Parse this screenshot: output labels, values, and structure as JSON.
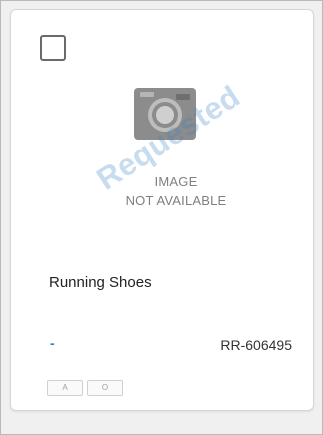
{
  "card": {
    "image_placeholder": {
      "icon": "camera-icon",
      "line1": "IMAGE",
      "line2": "NOT AVAILABLE"
    },
    "watermark": "Requested",
    "title": "Running Shoes",
    "price": "-",
    "sku": "RR-606495",
    "badges": [
      "A",
      "O"
    ]
  },
  "colors": {
    "watermark": "#3a80c6",
    "accent": "#3b7bd0"
  }
}
